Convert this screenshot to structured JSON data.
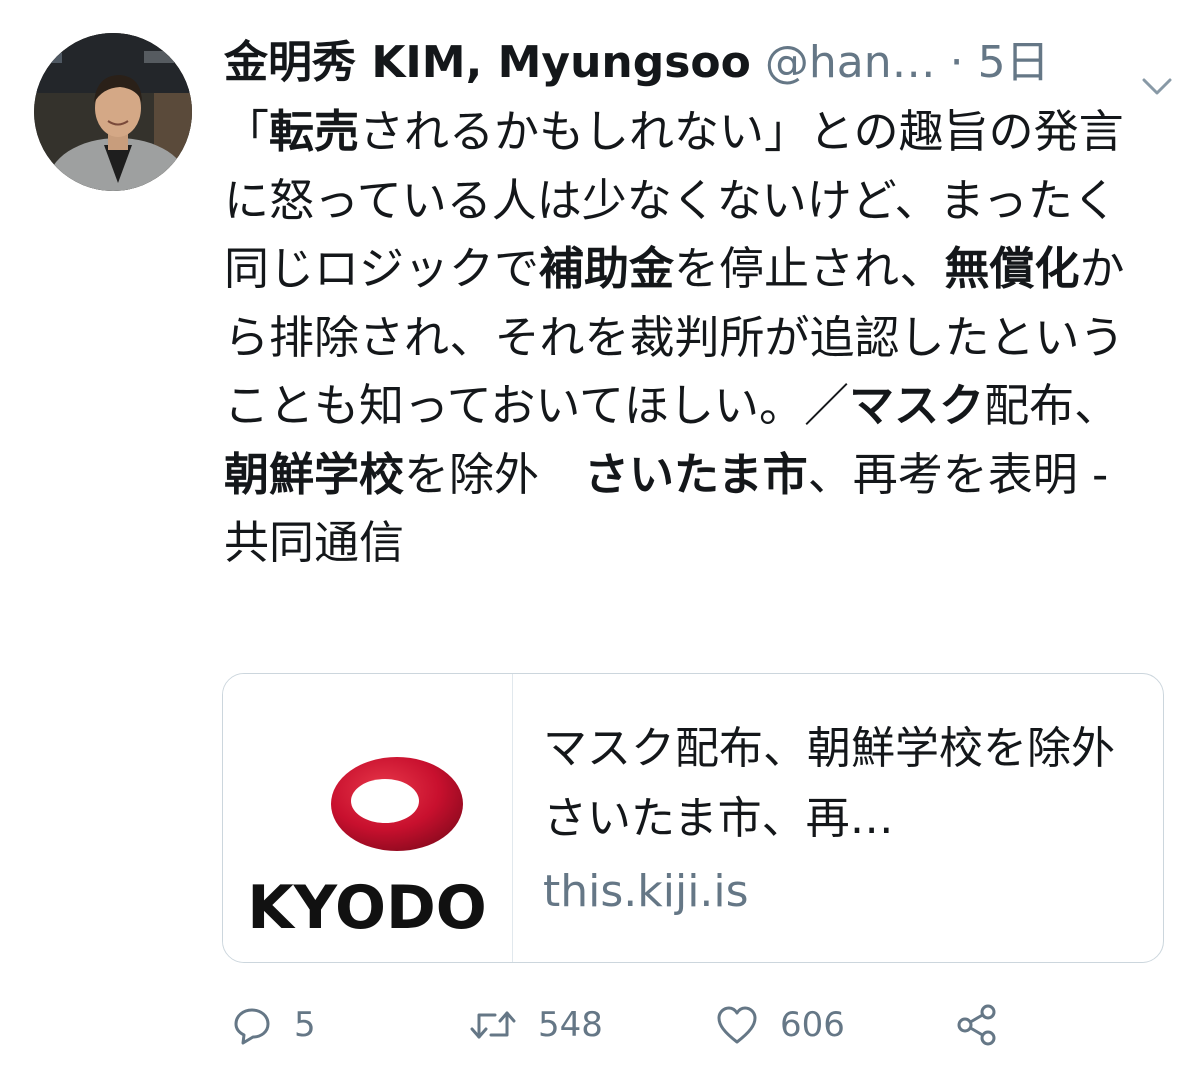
{
  "tweet": {
    "author_name": "金明秀 KIM, Myungsoo",
    "handle": "@han…",
    "separator": "·",
    "time": "5日",
    "text_segments": [
      {
        "text": "「",
        "bold": false
      },
      {
        "text": "転売",
        "bold": true
      },
      {
        "text": "されるかもしれない」との趣旨の発言に怒っている人は少なくないけど、まったく同じロジックで",
        "bold": false
      },
      {
        "text": "補助金",
        "bold": true
      },
      {
        "text": "を停止され、",
        "bold": false
      },
      {
        "text": "無償化",
        "bold": true
      },
      {
        "text": "から排除され、それを裁判所が追認したということも知っておいてほしい。／",
        "bold": false
      },
      {
        "text": "マスク",
        "bold": true
      },
      {
        "text": "配布、",
        "bold": false
      },
      {
        "text": "朝鮮学校",
        "bold": true
      },
      {
        "text": "を除外　",
        "bold": false
      },
      {
        "text": "さいたま市",
        "bold": true
      },
      {
        "text": "、再考を表明 - 共同通信",
        "bold": false
      }
    ]
  },
  "card": {
    "logo_text": "KYODO",
    "title": "マスク配布、朝鮮学校を除外　さいたま市、再…",
    "domain": "this.kiji.is"
  },
  "actions": {
    "reply_count": "5",
    "retweet_count": "548",
    "like_count": "606"
  },
  "icons": {
    "reply": "reply-icon",
    "retweet": "retweet-icon",
    "like": "heart-icon",
    "share": "share-icon",
    "menu": "chevron-down-icon"
  },
  "colors": {
    "text": "#14171a",
    "secondary": "#657786",
    "border": "#ccd6dd",
    "kyodo_red": "#c8102e"
  }
}
